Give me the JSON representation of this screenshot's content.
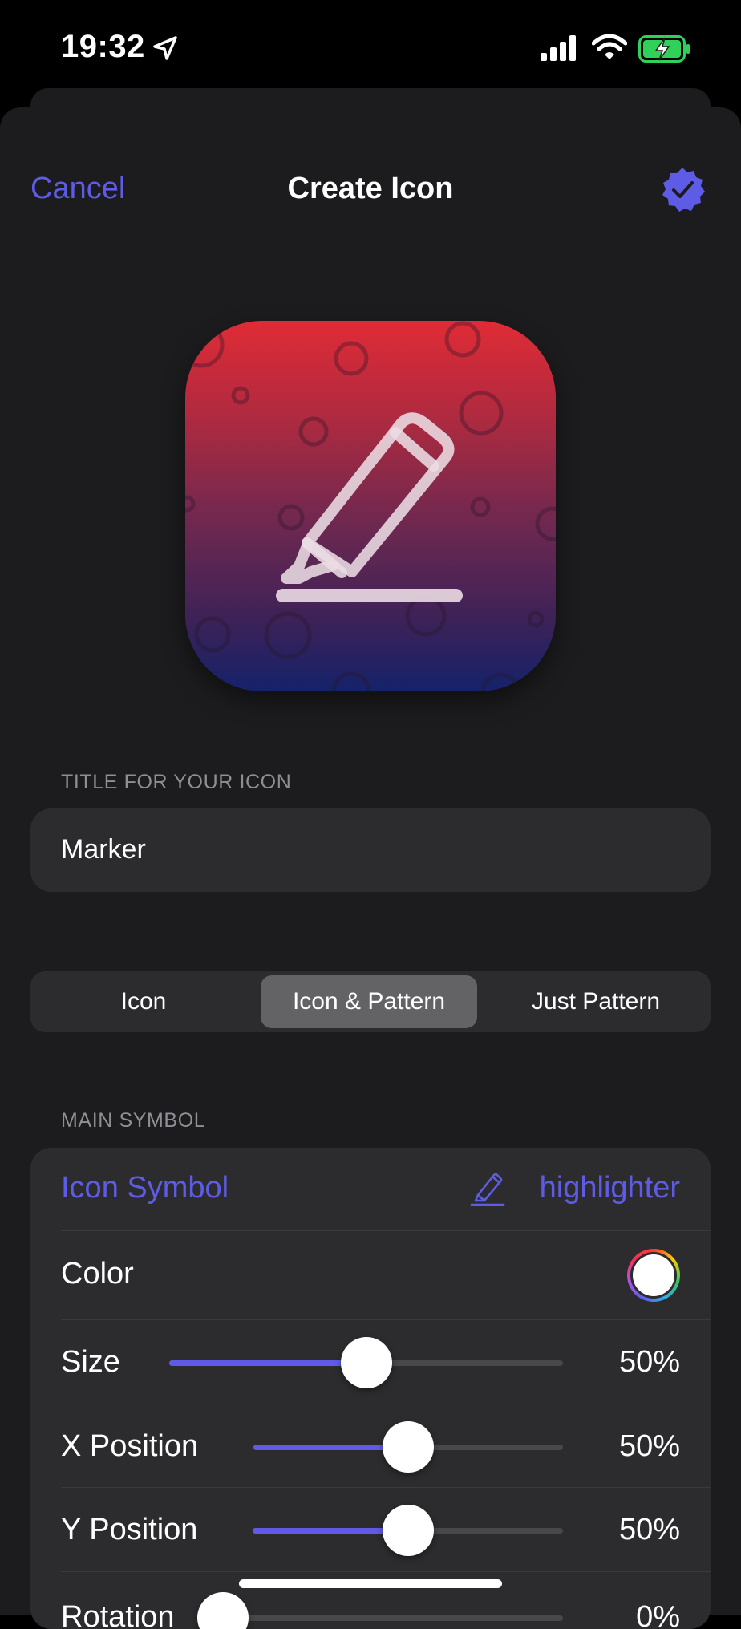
{
  "status_bar": {
    "time": "19:32",
    "icons": [
      "location-arrow-icon",
      "cellular-signal-icon",
      "wifi-icon",
      "battery-charging-icon"
    ],
    "battery_color": "#30d158"
  },
  "nav": {
    "cancel_label": "Cancel",
    "title": "Create Icon",
    "done_icon": "checkmark-seal-icon"
  },
  "colors": {
    "accent": "#5e5ce6",
    "background": "#1c1c1e",
    "cell": "#2c2c2e",
    "gradient_top": "#e02b36",
    "gradient_bottom": "#14226a"
  },
  "preview": {
    "symbol": "highlighter-icon",
    "pattern": "circles"
  },
  "title_section": {
    "header": "TITLE FOR YOUR ICON",
    "value": "Marker"
  },
  "style_picker": {
    "options": [
      "Icon",
      "Icon & Pattern",
      "Just Pattern"
    ],
    "selected": "Icon & Pattern"
  },
  "main_symbol": {
    "header": "MAIN SYMBOL",
    "icon_symbol_label": "Icon Symbol",
    "icon_symbol_value": "highlighter",
    "color_label": "Color",
    "color_value": "#ffffff",
    "size": {
      "label": "Size",
      "value_text": "50%",
      "value": 0.5
    },
    "x_position": {
      "label": "X Position",
      "value_text": "50%",
      "value": 0.5
    },
    "y_position": {
      "label": "Y Position",
      "value_text": "50%",
      "value": 0.5
    },
    "rotation": {
      "label": "Rotation",
      "value_text": "0%",
      "value": 0
    }
  }
}
